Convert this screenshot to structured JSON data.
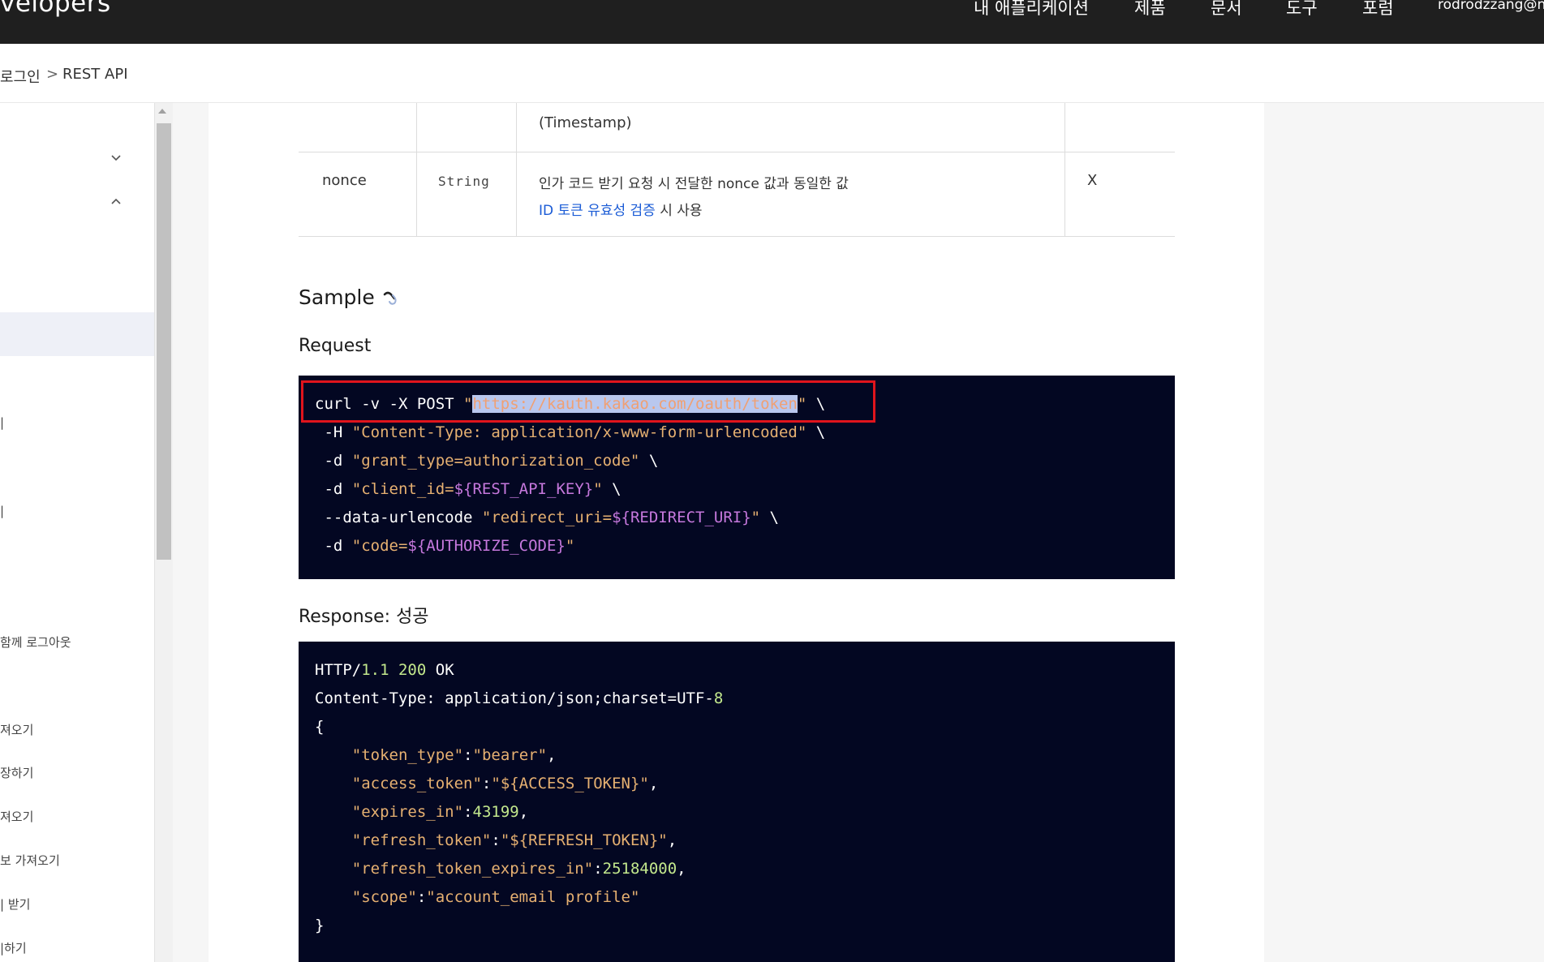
{
  "header": {
    "brand": "velopers",
    "nav": [
      "내 애플리케이션",
      "제품",
      "문서",
      "도구",
      "포럼"
    ],
    "user": "rodrodzzang@na"
  },
  "breadcrumb": {
    "parent": "로그인",
    "separator": ">",
    "current": "REST API"
  },
  "sidebar": {
    "items": [
      "|",
      "|",
      "함께 로그아웃",
      "져오기",
      "장하기",
      "져오기",
      "보 가져오기",
      "| 받기",
      "|하기"
    ]
  },
  "table": {
    "prev_row_desc": "(Timestamp)",
    "row": {
      "name": "nonce",
      "type": "String",
      "desc_line1": "인가 코드 받기 요청 시 전달한 nonce 값과 동일한 값",
      "desc_link": "ID 토큰 유효성 검증",
      "desc_line2_suffix": " 시 사용",
      "required": "X"
    }
  },
  "sample": {
    "title": "Sample",
    "request_label": "Request",
    "request": {
      "l1_cmd": "curl -v -X POST ",
      "l1_q1": "\"",
      "l1_url": "https://kauth.kakao.com/oauth/token",
      "l1_q2": "\"",
      "l1_tail": " \\",
      "l2_flag": " -H ",
      "l2_str": "\"Content-Type: application/x-www-form-urlencoded\"",
      "l2_tail": " \\",
      "l3_flag": " -d ",
      "l3_str": "\"grant_type=authorization_code\"",
      "l3_tail": " \\",
      "l4_flag": " -d ",
      "l4_str1": "\"client_id=",
      "l4_var": "${REST_API_KEY}",
      "l4_str2": "\"",
      "l4_tail": " \\",
      "l5_flag": " --data-urlencode ",
      "l5_str1": "\"redirect_uri=",
      "l5_var": "${REDIRECT_URI}",
      "l5_str2": "\"",
      "l5_tail": " \\",
      "l6_flag": " -d ",
      "l6_str1": "\"code=",
      "l6_var": "${AUTHORIZE_CODE}",
      "l6_str2": "\""
    },
    "response_label": "Response: 성공",
    "response": {
      "l1_a": "HTTP/",
      "l1_ver": "1.1",
      "l1_sp": " ",
      "l1_code": "200",
      "l1_b": " OK",
      "l2_a": "Content-Type: application/json;charset=UTF-",
      "l2_num": "8",
      "l3": "{",
      "k1": "\"token_type\"",
      "v1": "\"bearer\"",
      "k2": "\"access_token\"",
      "v2": "\"${ACCESS_TOKEN}\"",
      "k3": "\"expires_in\"",
      "v3": "43199",
      "k4": "\"refresh_token\"",
      "v4": "\"${REFRESH_TOKEN}\"",
      "k5": "\"refresh_token_expires_in\"",
      "v5": "25184000",
      "k6": "\"scope\"",
      "v6": "\"account_email profile\"",
      "close": "}"
    }
  },
  "colors": {
    "code_bg": "#030722",
    "string": "#e6b071",
    "variable": "#c678dd",
    "number": "#c3e88d",
    "highlight": "#e0141c",
    "link": "#1a5bd6"
  }
}
